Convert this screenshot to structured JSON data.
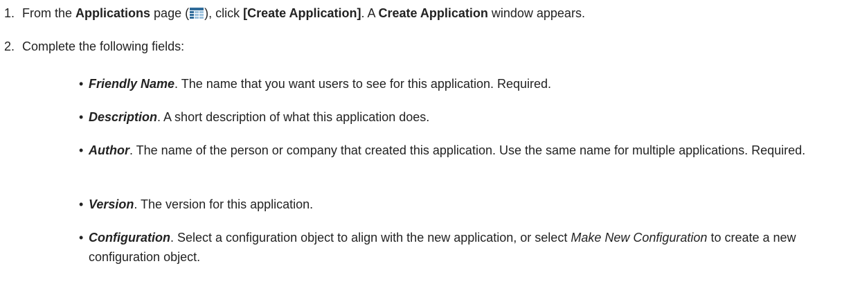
{
  "steps": [
    {
      "number": "1.",
      "t1": "From the ",
      "b1": "Applications",
      "t2": " page (",
      "icon": "applications-grid-icon",
      "t3": "), click ",
      "b2": "[Create Application]",
      "t4": ". A ",
      "b3": "Create Application",
      "t5": " window appears."
    },
    {
      "number": "2.",
      "text": "Complete the following fields:"
    }
  ],
  "fields": [
    {
      "name": "Friendly Name",
      "desc": ". The name that you want users to see for this application. Required."
    },
    {
      "name": "Description",
      "desc": ". A short description of what this application does."
    },
    {
      "name": "Author",
      "desc": ". The name of the person or company that created this application. Use the same name for multiple applications. Required."
    },
    {
      "name": "Version",
      "desc": ". The version for this application."
    },
    {
      "name": "Configuration",
      "desc_a": ". Select a configuration object to align with the new application, or select ",
      "desc_i": "Make New Configuration",
      "desc_b": " to create a new configuration object."
    }
  ],
  "colors": {
    "text": "#222222",
    "icon_dark": "#2f6b9a",
    "icon_light": "#9fc3de"
  }
}
